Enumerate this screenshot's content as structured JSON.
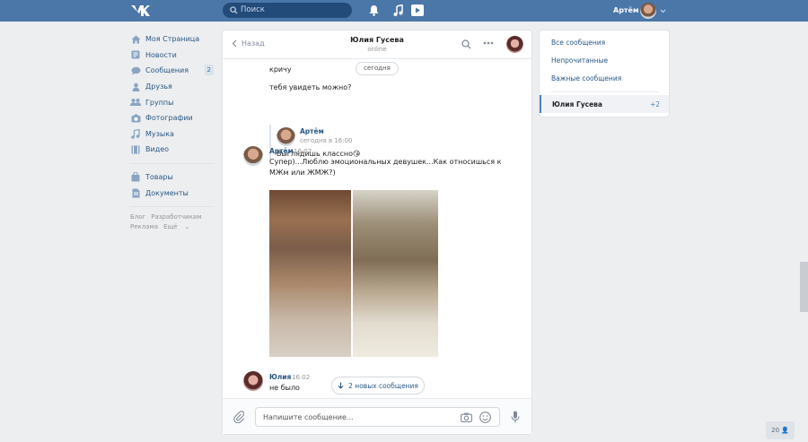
{
  "header": {
    "logo_icon": "vk-logo-icon",
    "search_placeholder": "Поиск",
    "user_name": "Артём",
    "accent": "#4a76a8"
  },
  "sidebar": {
    "items": [
      {
        "label": "Моя Страница",
        "icon": "home-icon"
      },
      {
        "label": "Новости",
        "icon": "news-icon"
      },
      {
        "label": "Сообщения",
        "icon": "chat-icon",
        "badge": "2"
      },
      {
        "label": "Друзья",
        "icon": "friends-icon"
      },
      {
        "label": "Группы",
        "icon": "groups-icon"
      },
      {
        "label": "Фотографии",
        "icon": "camera-icon"
      },
      {
        "label": "Музыка",
        "icon": "music-icon"
      },
      {
        "label": "Видео",
        "icon": "video-icon"
      }
    ],
    "items2": [
      {
        "label": "Товары",
        "icon": "bag-icon"
      },
      {
        "label": "Документы",
        "icon": "document-icon"
      }
    ],
    "links": [
      "Блог",
      "Разработчикам",
      "Реклама",
      "Ещё"
    ]
  },
  "chat": {
    "back_label": "Назад",
    "contact_name": "Юлия Гусева",
    "status": "online",
    "date_pill": "сегодня",
    "msg1": "кричу",
    "msg2": "тебя увидеть можно?",
    "quote": {
      "name": "Артём",
      "time": "сегодня в 16:00",
      "text": "Выглядишь классно😘"
    },
    "msg3": {
      "name": "Артём",
      "time": "16:02",
      "text1": "Супер)...Люблю эмоциональных девушек...Как относишься к",
      "text2": "МЖм или ЖМЖ?)"
    },
    "msg4": {
      "name": "Юлия",
      "time": "16:02",
      "text": "не было"
    },
    "new_messages": "2 новых сообщения",
    "composer_placeholder": "Напишите сообщение..."
  },
  "right_panel": {
    "all": "Все сообщения",
    "unread": "Непрочитанные",
    "important": "Важные сообщения",
    "active_name": "Юлия Гусева",
    "active_count": "+2"
  },
  "corner_badge": "20"
}
